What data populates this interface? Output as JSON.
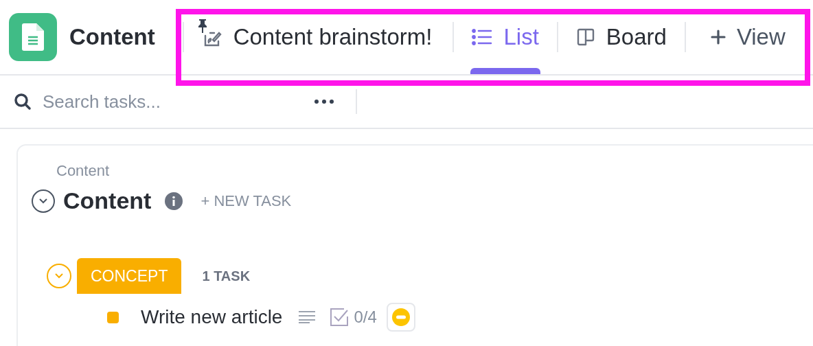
{
  "header": {
    "title": "Content"
  },
  "views": [
    {
      "kind": "whiteboard",
      "label": "Content brainstorm!",
      "selected": false,
      "pinned": true
    },
    {
      "kind": "list",
      "label": "List",
      "selected": true,
      "pinned": false
    },
    {
      "kind": "board",
      "label": "Board",
      "selected": false,
      "pinned": false
    },
    {
      "kind": "add",
      "label": "View",
      "selected": false,
      "pinned": false
    }
  ],
  "search": {
    "placeholder": "Search tasks..."
  },
  "list": {
    "breadcrumb": "Content",
    "title": "Content",
    "new_task": "+ NEW TASK",
    "expanded": true,
    "groups": [
      {
        "status": "CONCEPT",
        "color": "#f9ae00",
        "count": "1 TASK",
        "expanded": true,
        "tasks": [
          {
            "name": "Write new article",
            "checklist": "0/4"
          }
        ]
      }
    ]
  }
}
